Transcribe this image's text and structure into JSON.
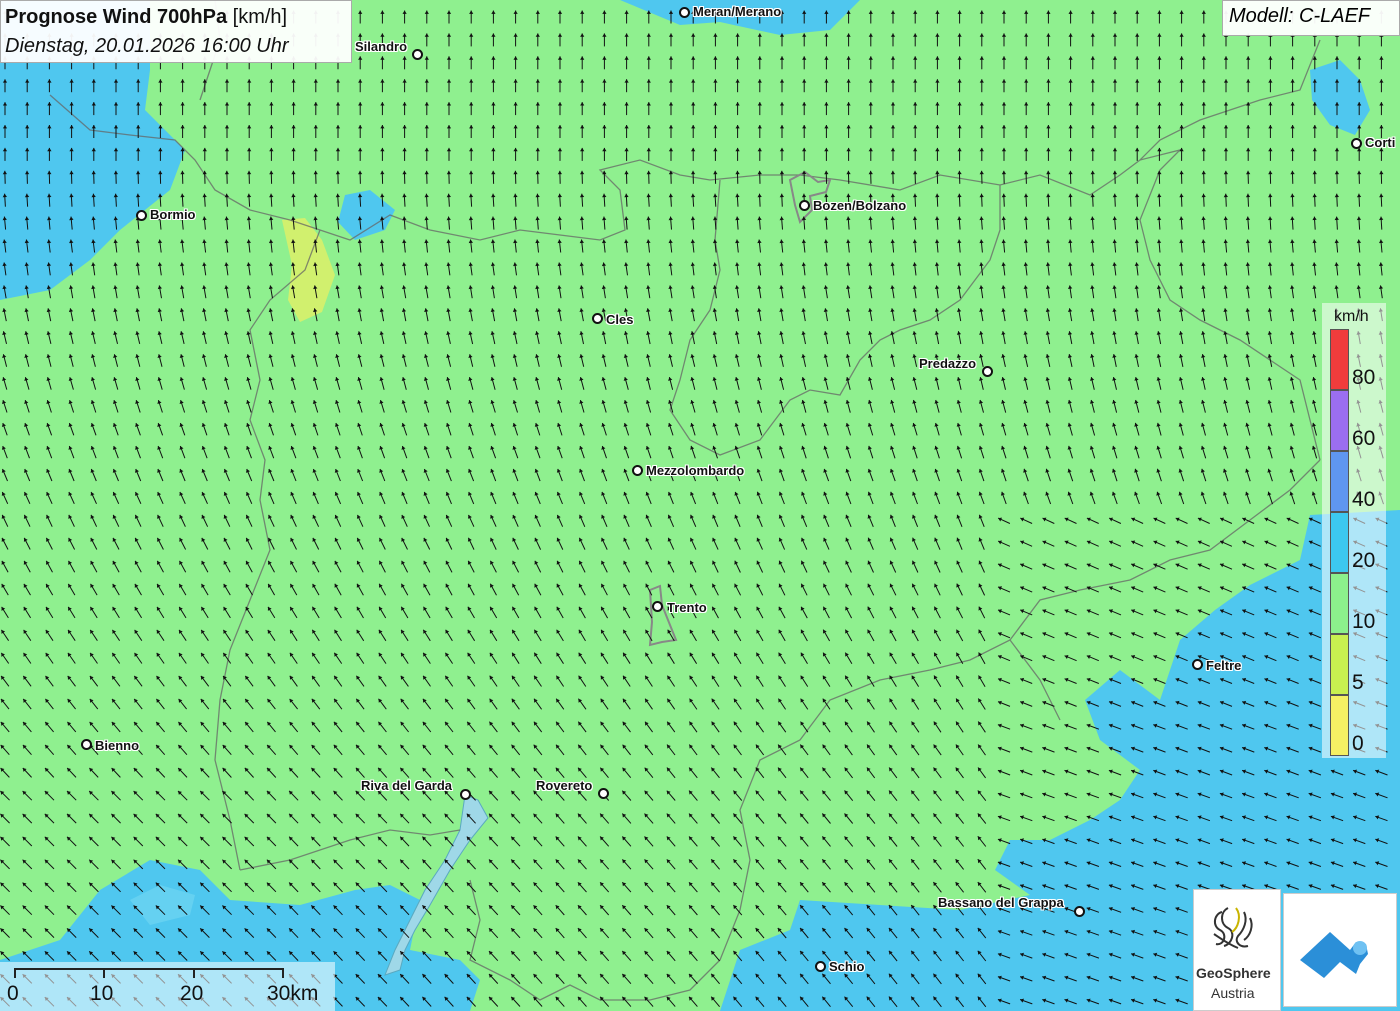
{
  "header": {
    "title_bold": "Prognose Wind 700hPa",
    "title_unit": " [km/h]",
    "subtitle": "Dienstag, 20.01.2026 16:00 Uhr"
  },
  "model": {
    "label": "Modell: C-LAEF"
  },
  "cities": [
    {
      "name": "Meran/Merano"
    },
    {
      "name": "Silandro"
    },
    {
      "name": "Corti"
    },
    {
      "name": "Bormio"
    },
    {
      "name": "Bozen/Bolzano"
    },
    {
      "name": "Cles"
    },
    {
      "name": "Predazzo"
    },
    {
      "name": "Mezzolombardo"
    },
    {
      "name": "Trento"
    },
    {
      "name": "Feltre"
    },
    {
      "name": "Bienno"
    },
    {
      "name": "Riva del Garda"
    },
    {
      "name": "Rovereto"
    },
    {
      "name": "Bassano del Grappa"
    },
    {
      "name": "Schio"
    }
  ],
  "legend": {
    "unit": "km/h",
    "classes": [
      {
        "label": "80",
        "color": "#f03c3c"
      },
      {
        "label": "60",
        "color": "#9b6ef0"
      },
      {
        "label": "40",
        "color": "#5f96f0"
      },
      {
        "label": "20",
        "color": "#3cc8f0"
      },
      {
        "label": "10",
        "color": "#8cf08c"
      },
      {
        "label": "5",
        "color": "#c8f050"
      },
      {
        "label": "0",
        "color": "#f5f064"
      }
    ]
  },
  "scale": {
    "labels": [
      "0",
      "10",
      "20",
      "30km"
    ]
  },
  "logos": {
    "geosphere_line1": "GeoSphere",
    "geosphere_line2": "Austria"
  },
  "colors": {
    "calm_green": "#8ff08f",
    "moderate_blue": "#4fc7ef",
    "light_yellow": "#d8f06a"
  }
}
